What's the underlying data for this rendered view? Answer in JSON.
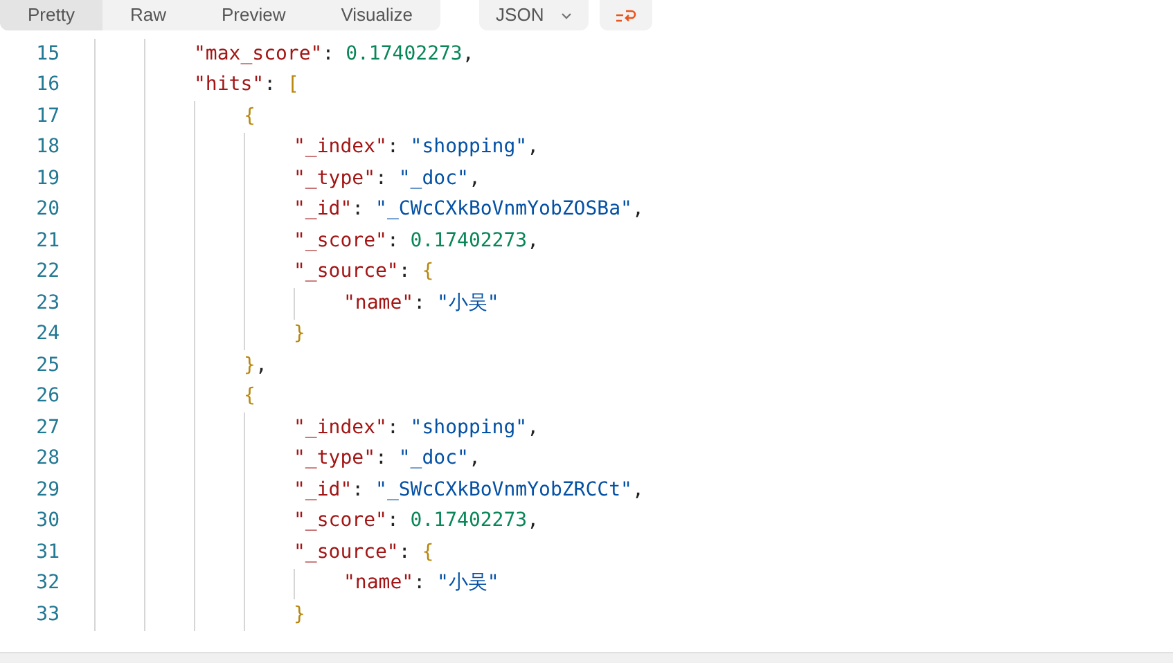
{
  "view_tabs": [
    {
      "label": "Pretty",
      "selected": true
    },
    {
      "label": "Raw",
      "selected": false
    },
    {
      "label": "Preview",
      "selected": false
    },
    {
      "label": "Visualize",
      "selected": false
    }
  ],
  "format_dropdown": {
    "value": "JSON"
  },
  "wrap_lines": {
    "on": true
  },
  "lines": [
    {
      "number": "15",
      "tokens": [
        {
          "kind": "key",
          "text": "\"max_score\""
        },
        {
          "kind": "punct",
          "text": ": "
        },
        {
          "kind": "number",
          "text": "0.17402273"
        },
        {
          "kind": "punct",
          "text": ","
        }
      ]
    },
    {
      "number": "16",
      "tokens": [
        {
          "kind": "key",
          "text": "\"hits\""
        },
        {
          "kind": "punct",
          "text": ": "
        },
        {
          "kind": "bracket",
          "text": "["
        }
      ],
      "children": [
        {
          "number": "17",
          "tokens": [
            {
              "kind": "bracket",
              "text": "{"
            }
          ],
          "children": [
            {
              "number": "18",
              "tokens": [
                {
                  "kind": "key",
                  "text": "\"_index\""
                },
                {
                  "kind": "punct",
                  "text": ": "
                },
                {
                  "kind": "string",
                  "text": "\"shopping\""
                },
                {
                  "kind": "punct",
                  "text": ","
                }
              ]
            },
            {
              "number": "19",
              "tokens": [
                {
                  "kind": "key",
                  "text": "\"_type\""
                },
                {
                  "kind": "punct",
                  "text": ": "
                },
                {
                  "kind": "string",
                  "text": "\"_doc\""
                },
                {
                  "kind": "punct",
                  "text": ","
                }
              ]
            },
            {
              "number": "20",
              "tokens": [
                {
                  "kind": "key",
                  "text": "\"_id\""
                },
                {
                  "kind": "punct",
                  "text": ": "
                },
                {
                  "kind": "string",
                  "text": "\"_CWcCXkBoVnmYobZOSBa\""
                },
                {
                  "kind": "punct",
                  "text": ","
                }
              ]
            },
            {
              "number": "21",
              "tokens": [
                {
                  "kind": "key",
                  "text": "\"_score\""
                },
                {
                  "kind": "punct",
                  "text": ": "
                },
                {
                  "kind": "number",
                  "text": "0.17402273"
                },
                {
                  "kind": "punct",
                  "text": ","
                }
              ]
            },
            {
              "number": "22",
              "tokens": [
                {
                  "kind": "key",
                  "text": "\"_source\""
                },
                {
                  "kind": "punct",
                  "text": ": "
                },
                {
                  "kind": "bracket",
                  "text": "{"
                }
              ],
              "children": [
                {
                  "number": "23",
                  "tokens": [
                    {
                      "kind": "key",
                      "text": "\"name\""
                    },
                    {
                      "kind": "punct",
                      "text": ": "
                    },
                    {
                      "kind": "string",
                      "text": "\"小吴\""
                    }
                  ]
                }
              ]
            },
            {
              "number": "24",
              "tokens": [
                {
                  "kind": "bracket",
                  "text": "}"
                }
              ]
            }
          ]
        },
        {
          "number": "25",
          "tokens": [
            {
              "kind": "bracket",
              "text": "}"
            },
            {
              "kind": "punct",
              "text": ","
            }
          ]
        },
        {
          "number": "26",
          "tokens": [
            {
              "kind": "bracket",
              "text": "{"
            }
          ],
          "children": [
            {
              "number": "27",
              "tokens": [
                {
                  "kind": "key",
                  "text": "\"_index\""
                },
                {
                  "kind": "punct",
                  "text": ": "
                },
                {
                  "kind": "string",
                  "text": "\"shopping\""
                },
                {
                  "kind": "punct",
                  "text": ","
                }
              ]
            },
            {
              "number": "28",
              "tokens": [
                {
                  "kind": "key",
                  "text": "\"_type\""
                },
                {
                  "kind": "punct",
                  "text": ": "
                },
                {
                  "kind": "string",
                  "text": "\"_doc\""
                },
                {
                  "kind": "punct",
                  "text": ","
                }
              ]
            },
            {
              "number": "29",
              "tokens": [
                {
                  "kind": "key",
                  "text": "\"_id\""
                },
                {
                  "kind": "punct",
                  "text": ": "
                },
                {
                  "kind": "string",
                  "text": "\"_SWcCXkBoVnmYobZRCCt\""
                },
                {
                  "kind": "punct",
                  "text": ","
                }
              ]
            },
            {
              "number": "30",
              "tokens": [
                {
                  "kind": "key",
                  "text": "\"_score\""
                },
                {
                  "kind": "punct",
                  "text": ": "
                },
                {
                  "kind": "number",
                  "text": "0.17402273"
                },
                {
                  "kind": "punct",
                  "text": ","
                }
              ]
            },
            {
              "number": "31",
              "tokens": [
                {
                  "kind": "key",
                  "text": "\"_source\""
                },
                {
                  "kind": "punct",
                  "text": ": "
                },
                {
                  "kind": "bracket",
                  "text": "{"
                }
              ],
              "children": [
                {
                  "number": "32",
                  "tokens": [
                    {
                      "kind": "key",
                      "text": "\"name\""
                    },
                    {
                      "kind": "punct",
                      "text": ": "
                    },
                    {
                      "kind": "string",
                      "text": "\"小吴\""
                    }
                  ]
                }
              ]
            },
            {
              "number": "33",
              "tokens": [
                {
                  "kind": "bracket",
                  "text": "}"
                }
              ]
            }
          ]
        }
      ]
    }
  ]
}
